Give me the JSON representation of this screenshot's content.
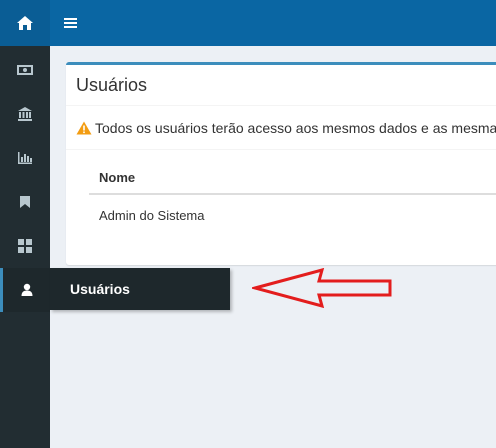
{
  "topbar": {
    "logo_icon": "home-icon",
    "menu_icon": "hamburger-menu-icon",
    "color": "#0a66a3"
  },
  "sidebar": {
    "items": [
      {
        "icon": "money-icon"
      },
      {
        "icon": "bank-icon"
      },
      {
        "icon": "bar-chart-icon"
      },
      {
        "icon": "bookmark-icon"
      },
      {
        "icon": "dashboard-grid-icon"
      },
      {
        "icon": "user-icon",
        "active": true
      }
    ],
    "flyout_label": "Usuários"
  },
  "panel": {
    "title": "Usuários",
    "alert_icon": "warning-icon",
    "alert_text": "Todos os usuários terão acesso aos mesmos dados e as mesmas",
    "table": {
      "columns": [
        "Nome"
      ],
      "rows": [
        [
          "Admin do Sistema"
        ]
      ]
    }
  },
  "annotation": {
    "type": "red-arrow",
    "points_to": "Usuários",
    "color": "#e31d1d"
  }
}
